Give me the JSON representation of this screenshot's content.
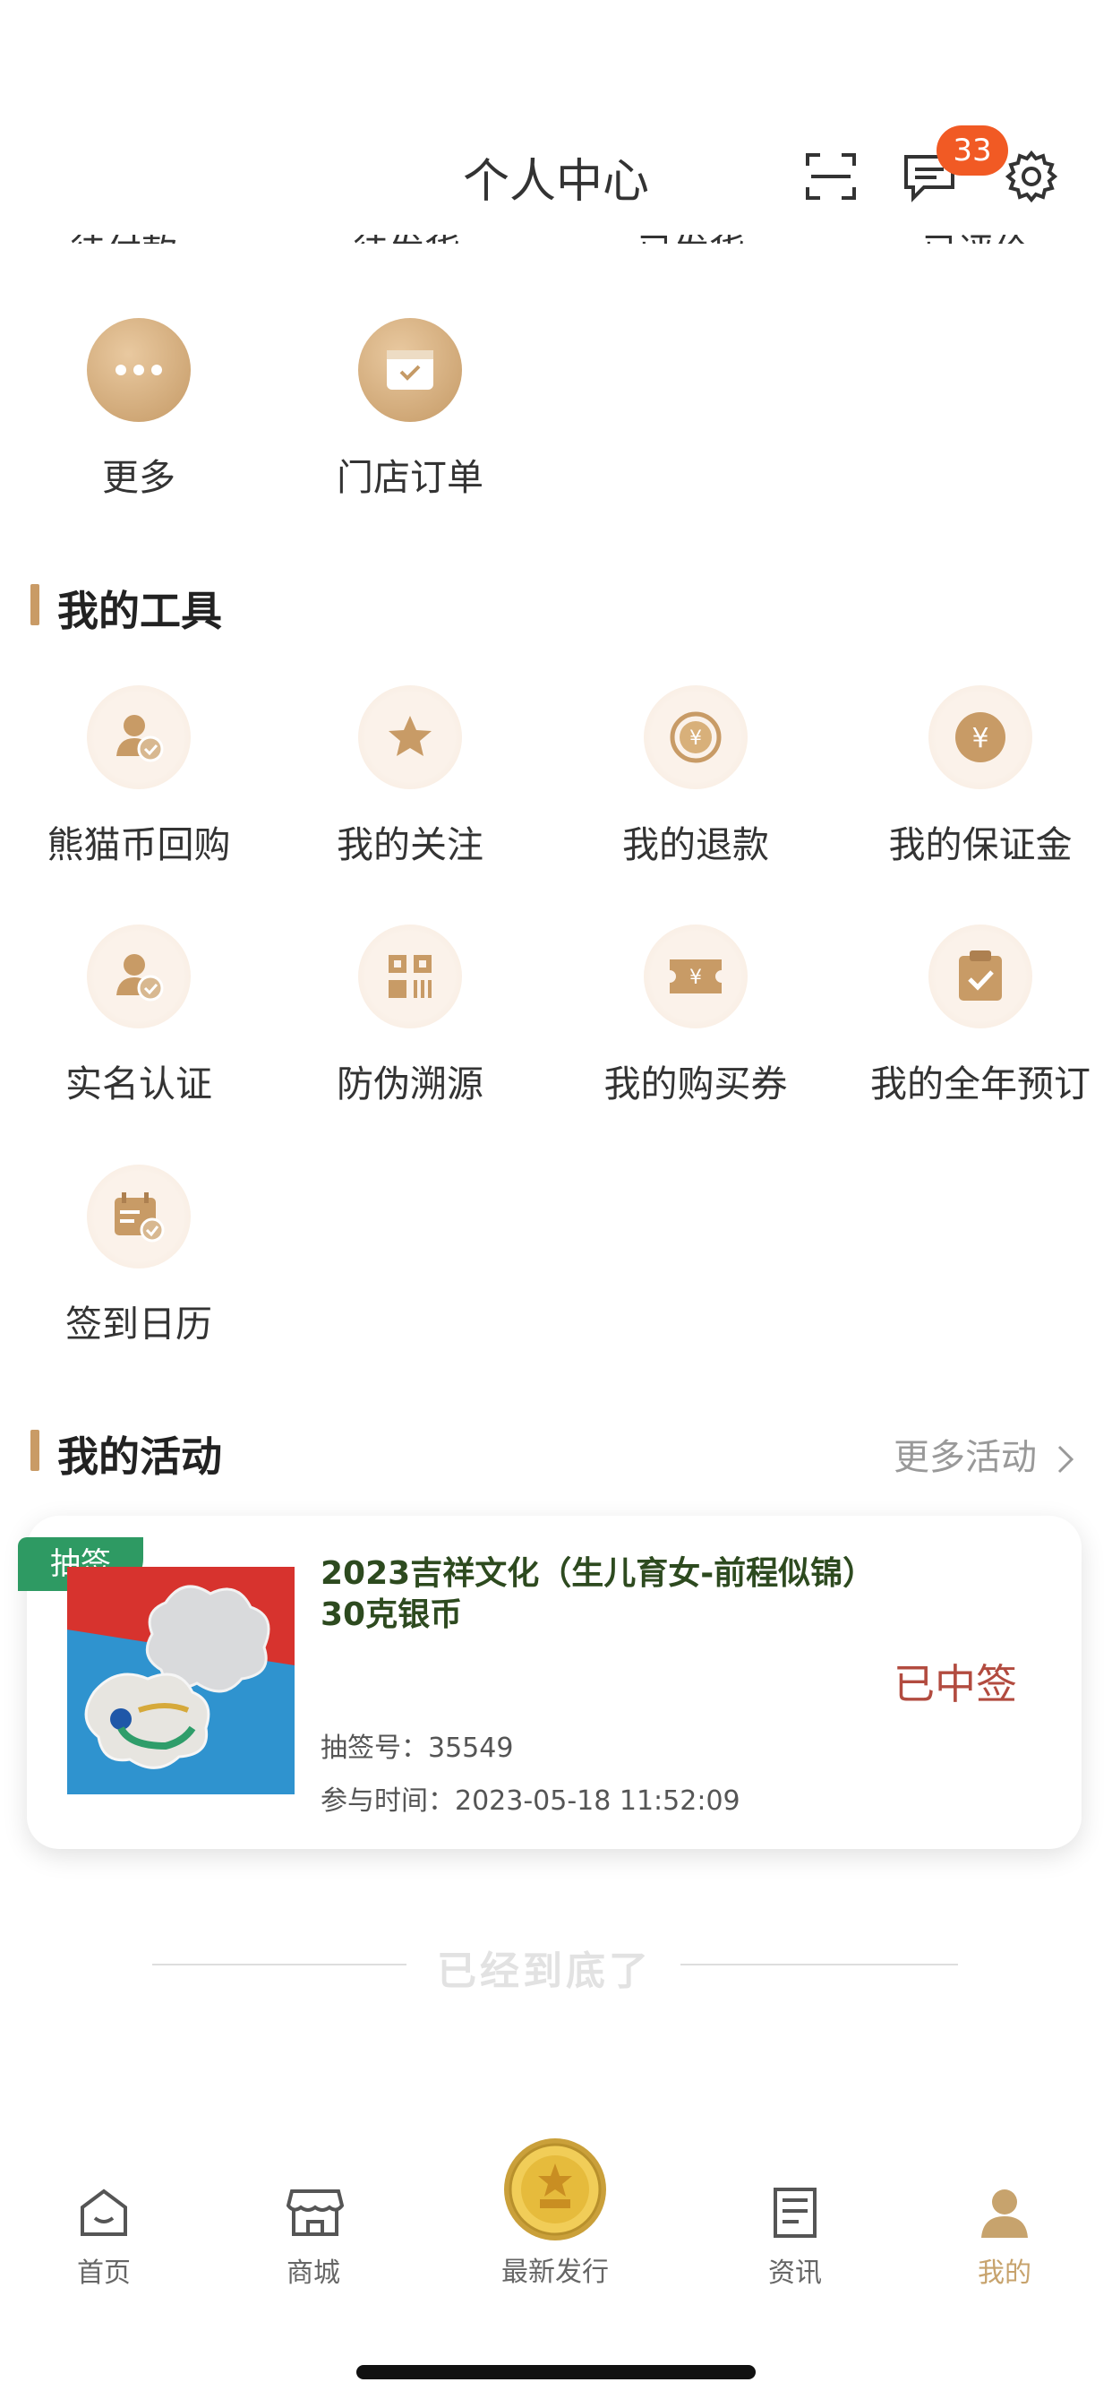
{
  "header": {
    "title": "个人中心",
    "badge_count": "33",
    "icons": [
      "scan-icon",
      "message-icon",
      "settings-icon"
    ]
  },
  "order_status_row": [
    "待付款",
    "待发货",
    "已发货",
    "已评价"
  ],
  "orders_more": [
    {
      "label": "更多",
      "icon": "more-icon"
    },
    {
      "label": "门店订单",
      "icon": "store-order-icon"
    }
  ],
  "tools": {
    "title": "我的工具",
    "items": [
      {
        "label": "熊猫币回购",
        "icon": "user-check-icon"
      },
      {
        "label": "我的关注",
        "icon": "star-icon"
      },
      {
        "label": "我的退款",
        "icon": "refund-icon"
      },
      {
        "label": "我的保证金",
        "icon": "yuan-coin-icon"
      },
      {
        "label": "实名认证",
        "icon": "user-check-icon"
      },
      {
        "label": "防伪溯源",
        "icon": "qr-code-icon"
      },
      {
        "label": "我的购买券",
        "icon": "ticket-icon"
      },
      {
        "label": "我的全年预订",
        "icon": "clipboard-check-icon"
      },
      {
        "label": "签到日历",
        "icon": "calendar-check-icon"
      }
    ]
  },
  "activities": {
    "title": "我的活动",
    "more": "更多活动",
    "card": {
      "tag": "抽签",
      "title": "2023吉祥文化（生儿育女-前程似锦）30克银币",
      "status": "已中签",
      "lottery_no": "抽签号：35549",
      "time": "参与时间：2023-05-18 11:52:09"
    }
  },
  "end_text": "已经到底了",
  "tabs": [
    {
      "label": "首页",
      "icon": "home-icon"
    },
    {
      "label": "商城",
      "icon": "shop-icon"
    },
    {
      "label": "最新发行",
      "icon": "coin-emblem-icon"
    },
    {
      "label": "资讯",
      "icon": "news-icon"
    },
    {
      "label": "我的",
      "icon": "profile-icon",
      "active": true
    }
  ],
  "colors": {
    "gold": "#c99b66",
    "badge": "#f15a24",
    "tag_green": "#2e9a63",
    "won_red": "#b24b3f",
    "active_tab": "#c7a36d"
  }
}
